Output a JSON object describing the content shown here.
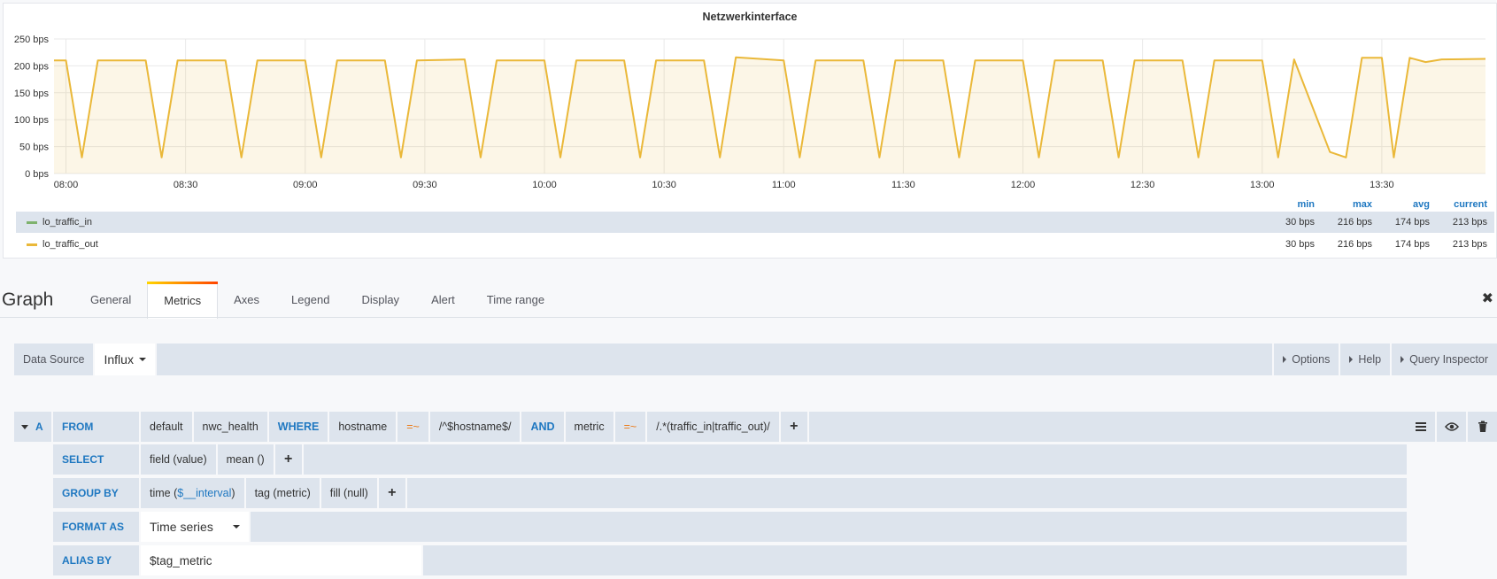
{
  "panel": {
    "title": "Netzwerkinterface",
    "legend": {
      "headers": [
        "min",
        "max",
        "avg",
        "current"
      ],
      "series": [
        {
          "name": "lo_traffic_in",
          "color": "#7eb26d",
          "min": "30 bps",
          "max": "216 bps",
          "avg": "174 bps",
          "current": "213 bps"
        },
        {
          "name": "lo_traffic_out",
          "color": "#eab839",
          "min": "30 bps",
          "max": "216 bps",
          "avg": "174 bps",
          "current": "213 bps"
        }
      ]
    }
  },
  "chart_data": {
    "type": "area",
    "title": "Netzwerkinterface",
    "xlabel": "",
    "ylabel": "",
    "y_ticks": [
      "0 bps",
      "50 bps",
      "100 bps",
      "150 bps",
      "200 bps",
      "250 bps"
    ],
    "ylim": [
      0,
      250
    ],
    "x_ticks": [
      "08:00",
      "08:30",
      "09:00",
      "09:30",
      "10:00",
      "10:30",
      "11:00",
      "11:30",
      "12:00",
      "12:30",
      "13:00",
      "13:30"
    ],
    "xlim": [
      "07:57",
      "13:56"
    ],
    "grid": true,
    "series": [
      {
        "name": "lo_traffic_out",
        "color": "#eab839",
        "x": [
          "07:57",
          "08:00",
          "08:04",
          "08:08",
          "08:20",
          "08:24",
          "08:28",
          "08:40",
          "08:44",
          "08:48",
          "09:00",
          "09:04",
          "09:08",
          "09:20",
          "09:24",
          "09:28",
          "09:40",
          "09:44",
          "09:48",
          "10:00",
          "10:04",
          "10:08",
          "10:20",
          "10:24",
          "10:28",
          "10:40",
          "10:44",
          "10:48",
          "11:00",
          "11:04",
          "11:08",
          "11:20",
          "11:24",
          "11:28",
          "11:40",
          "11:44",
          "11:48",
          "12:00",
          "12:04",
          "12:08",
          "12:20",
          "12:24",
          "12:28",
          "12:40",
          "12:44",
          "12:48",
          "13:00",
          "13:04",
          "13:08",
          "13:17",
          "13:21",
          "13:25",
          "13:30",
          "13:33",
          "13:37",
          "13:41",
          "13:45",
          "13:56"
        ],
        "y": [
          210,
          210,
          30,
          210,
          210,
          30,
          210,
          210,
          30,
          210,
          210,
          30,
          210,
          210,
          30,
          210,
          212,
          30,
          210,
          210,
          30,
          210,
          210,
          30,
          210,
          210,
          30,
          216,
          210,
          30,
          210,
          210,
          30,
          210,
          210,
          30,
          210,
          210,
          30,
          210,
          210,
          30,
          210,
          210,
          30,
          210,
          210,
          30,
          212,
          40,
          30,
          215,
          215,
          30,
          215,
          207,
          212,
          213
        ]
      },
      {
        "name": "lo_traffic_in",
        "color": "#7eb26d",
        "x": [],
        "y": []
      }
    ]
  },
  "editor": {
    "title": "Graph",
    "tabs": [
      "General",
      "Metrics",
      "Axes",
      "Legend",
      "Display",
      "Alert",
      "Time range"
    ],
    "active_tab": "Metrics"
  },
  "datasource": {
    "label": "Data Source",
    "value": "Influx",
    "options_label": "Options",
    "help_label": "Help",
    "inspector_label": "Query Inspector"
  },
  "query": {
    "ref_id": "A",
    "from_kw": "FROM",
    "policy": "default",
    "measurement": "nwc_health",
    "where_kw": "WHERE",
    "tag1": "hostname",
    "op1": "=~",
    "val1": "/^$hostname$/",
    "and_kw": "AND",
    "tag2": "metric",
    "op2": "=~",
    "val2": "/.*(traffic_in|traffic_out)/",
    "select_kw": "SELECT",
    "field": "field (value)",
    "agg": "mean ()",
    "groupby_kw": "GROUP BY",
    "time_pre": "time (",
    "time_var": "$__interval",
    "time_post": ")",
    "tag_group": "tag (metric)",
    "fill": "fill (null)",
    "format_kw": "FORMAT AS",
    "format_value": "Time series",
    "alias_kw": "ALIAS BY",
    "alias_value": "$tag_metric"
  }
}
